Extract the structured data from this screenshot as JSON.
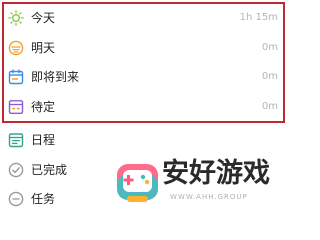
{
  "items": [
    {
      "label": "今天",
      "duration": "1h 15m",
      "icon": "sun-icon",
      "color": "#8bc34a"
    },
    {
      "label": "明天",
      "duration": "0m",
      "icon": "sunset-icon",
      "color": "#f0a030"
    },
    {
      "label": "即将到来",
      "duration": "0m",
      "icon": "calendar-icon",
      "color": "#3b8de6"
    },
    {
      "label": "待定",
      "duration": "0m",
      "icon": "inbox-icon",
      "color": "#8a5cd0"
    },
    {
      "label": "日程",
      "icon": "schedule-icon",
      "color": "#2fa58c"
    },
    {
      "label": "已完成",
      "icon": "check-circle-icon",
      "color": "#999999"
    },
    {
      "label": "任务",
      "icon": "task-icon",
      "color": "#999999"
    }
  ],
  "highlight_color": "#c0282f",
  "watermark": {
    "title": "安好游戏",
    "subtitle": "WWW.AHH.GROUP"
  }
}
